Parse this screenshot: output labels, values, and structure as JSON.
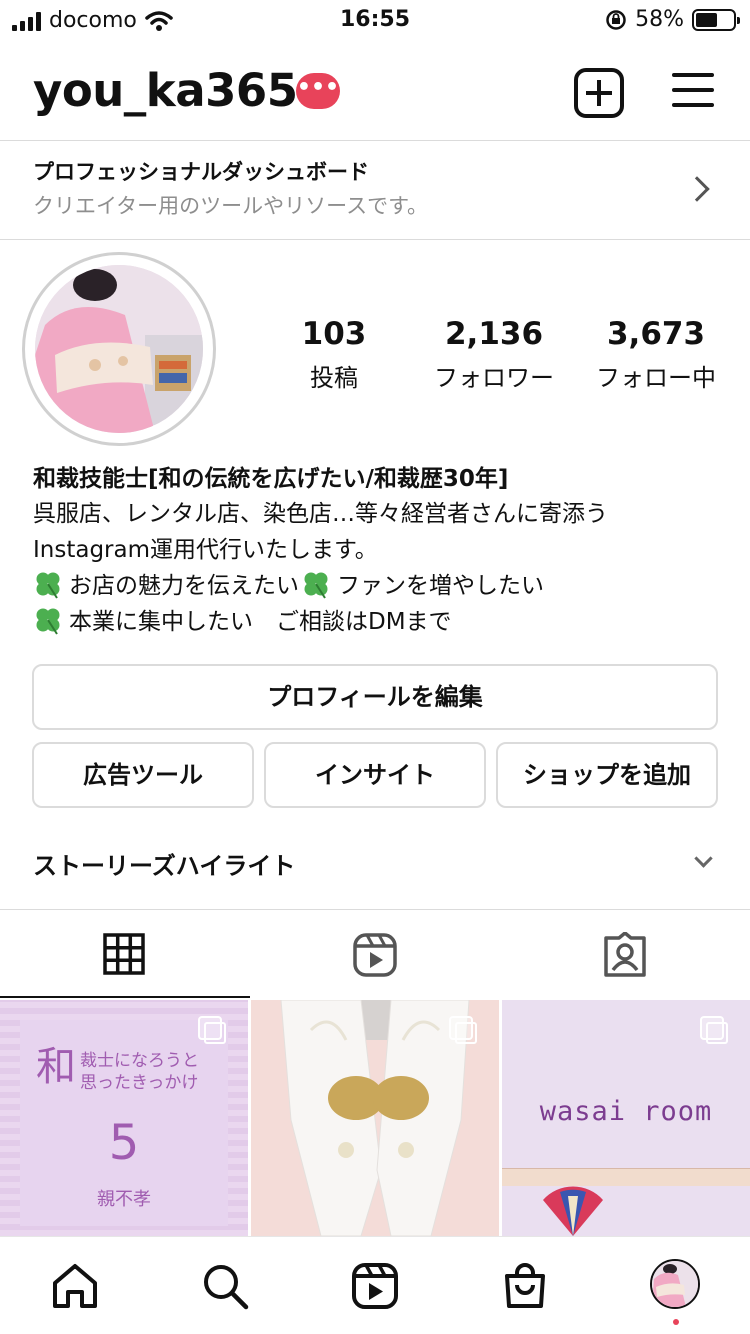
{
  "status_bar": {
    "carrier": "docomo",
    "time": "16:55",
    "battery_percent": "58%",
    "battery_level": 0.58
  },
  "header": {
    "username": "you_ka365",
    "badge": "•••",
    "icons": [
      "new-post-icon",
      "menu-icon"
    ]
  },
  "dashboard": {
    "title": "プロフェッショナルダッシュボード",
    "subtitle": "クリエイター用のツールやリソースです。"
  },
  "stats": [
    {
      "value": "103",
      "label": "投稿"
    },
    {
      "value": "2,136",
      "label": "フォロワー"
    },
    {
      "value": "3,673",
      "label": "フォロー中"
    }
  ],
  "bio": {
    "name": "和裁技能士[和の伝統を広げたい/和裁歴30年]",
    "line1": "呉服店、レンタル店、染色店…等々経営者さんに寄添う",
    "line2": "Instagram運用代行いたします。",
    "line3a": "お店の魅力を伝えたい",
    "line3b": "ファンを増やしたい",
    "line4": "本業に集中したい　ご相談はDMまで"
  },
  "buttons": {
    "edit_profile": "プロフィールを編集",
    "ad_tools": "広告ツール",
    "insights": "インサイト",
    "add_shop": "ショップを追加"
  },
  "highlights_label": "ストーリーズハイライト",
  "tabs": [
    "grid-icon",
    "reels-icon",
    "tagged-icon"
  ],
  "posts": {
    "p1_big": "和",
    "p1_line1": "裁士になろうと",
    "p1_line2": "思ったきっかけ",
    "p1_number": "5",
    "p1_footer": "親不孝",
    "p3_text": "wasai room"
  },
  "bottom_nav": [
    "home-icon",
    "search-icon",
    "reels-icon",
    "shop-icon",
    "profile-avatar"
  ],
  "colors": {
    "badge": "#e8435a",
    "post_text": "#a05cb0",
    "secondary_text": "#8e8e8e"
  }
}
